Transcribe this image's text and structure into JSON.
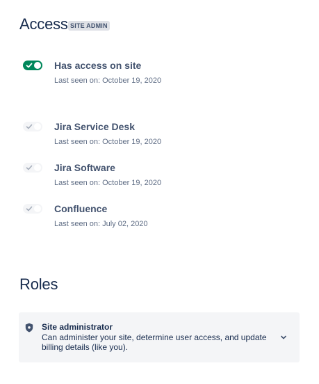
{
  "access": {
    "title": "Access",
    "badge": "SITE ADMIN",
    "primary": {
      "label": "Has access on site",
      "last_seen": "Last seen on: October 19, 2020",
      "enabled": true
    },
    "products": [
      {
        "label": "Jira Service Desk",
        "last_seen": "Last seen on: October 19, 2020",
        "enabled": false
      },
      {
        "label": "Jira Software",
        "last_seen": "Last seen on: October 19, 2020",
        "enabled": false
      },
      {
        "label": "Confluence",
        "last_seen": "Last seen on: July 02, 2020",
        "enabled": false
      }
    ]
  },
  "roles": {
    "title": "Roles",
    "items": [
      {
        "title": "Site administrator",
        "description": "Can administer your site, determine user access, and update billing details (like you).",
        "icon": "shield-icon"
      }
    ]
  },
  "colors": {
    "toggle_on": "#00875a",
    "toggle_off": "#f4f5f7",
    "text_primary": "#172b4d",
    "text_secondary": "#42526e",
    "card_bg": "#f4f5f7"
  }
}
